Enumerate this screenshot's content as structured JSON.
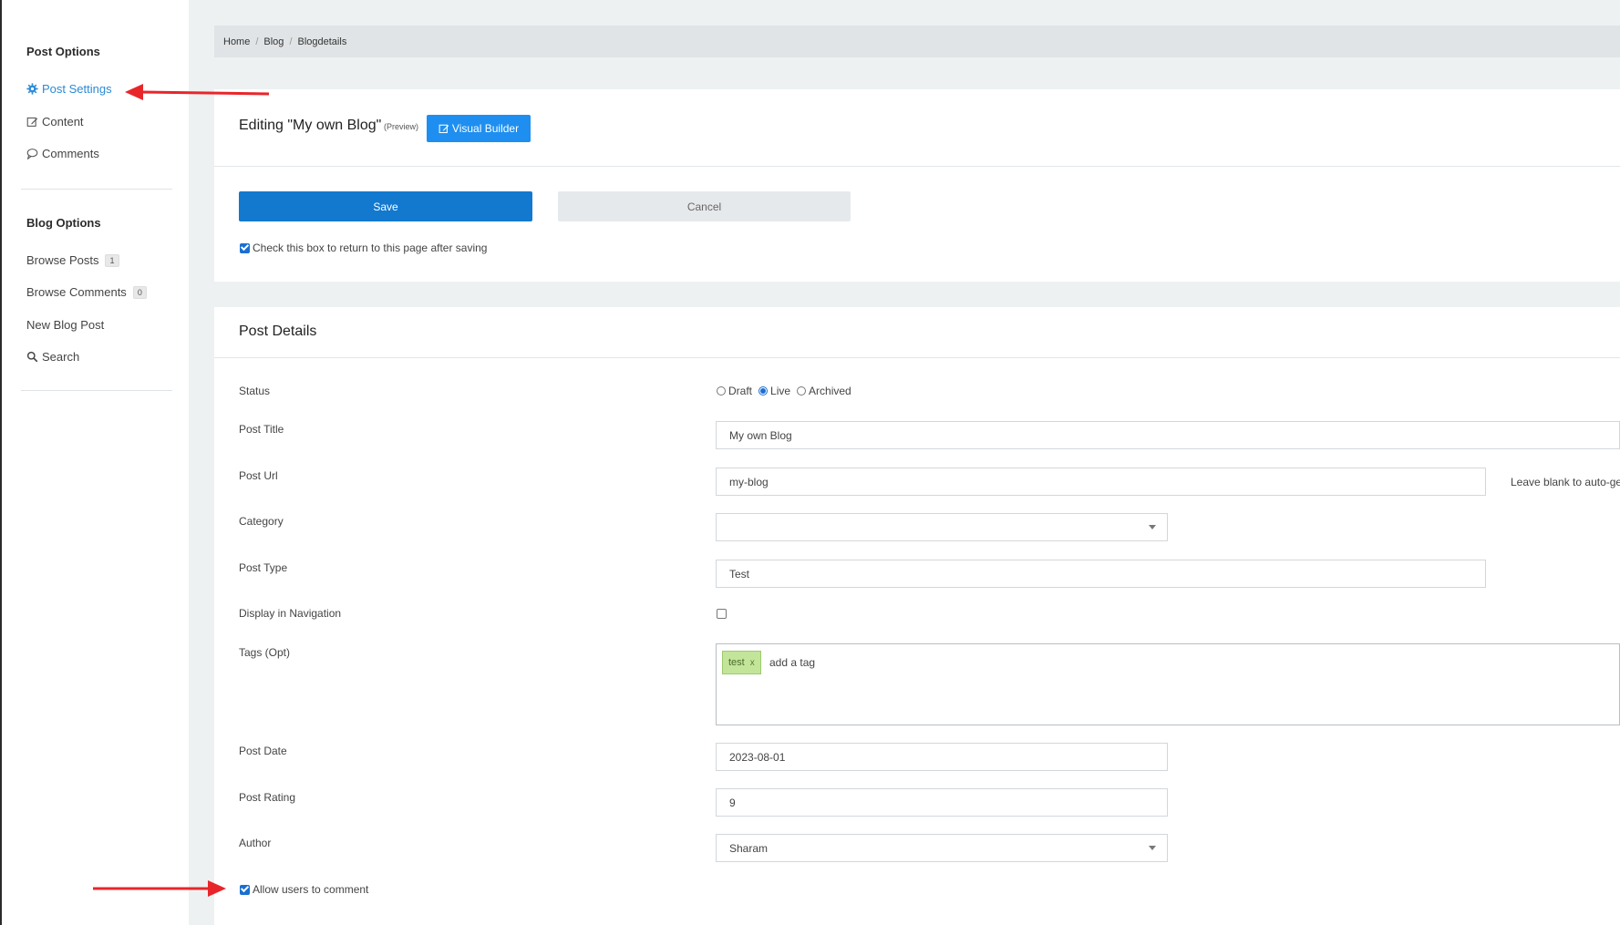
{
  "sidebar": {
    "post_options_title": "Post Options",
    "post_settings": "Post Settings",
    "content": "Content",
    "comments": "Comments",
    "blog_options_title": "Blog Options",
    "browse_posts": "Browse Posts",
    "browse_posts_count": "1",
    "browse_comments": "Browse Comments",
    "browse_comments_count": "0",
    "new_blog_post": "New Blog Post",
    "search": "Search"
  },
  "breadcrumb": {
    "home": "Home",
    "blog": "Blog",
    "current": "Blogdetails",
    "separator": "/"
  },
  "header": {
    "editing_title": "Editing \"My own Blog\"",
    "preview": "(Preview)",
    "visual_builder": "Visual Builder"
  },
  "actions": {
    "save": "Save",
    "cancel": "Cancel",
    "return_checkbox_label": "Check this box to return to this page after saving",
    "return_checked": true
  },
  "post_details": {
    "title": "Post Details",
    "status": {
      "label": "Status",
      "options": [
        "Draft",
        "Live",
        "Archived"
      ],
      "selected": "Live"
    },
    "post_title": {
      "label": "Post Title",
      "value": "My own Blog"
    },
    "post_url": {
      "label": "Post Url",
      "value": "my-blog",
      "hint": "Leave blank to auto-ge"
    },
    "category": {
      "label": "Category",
      "value": ""
    },
    "post_type": {
      "label": "Post Type",
      "value": "Test"
    },
    "display_in_navigation": {
      "label": "Display in Navigation",
      "checked": false
    },
    "tags": {
      "label": "Tags (Opt)",
      "items": [
        "test"
      ],
      "remove_glyph": "x",
      "placeholder": "add a tag"
    },
    "post_date": {
      "label": "Post Date",
      "value": "2023-08-01"
    },
    "post_rating": {
      "label": "Post Rating",
      "value": "9"
    },
    "author": {
      "label": "Author",
      "value": "Sharam"
    },
    "allow_comments": {
      "label": "Allow users to comment",
      "checked": true
    }
  },
  "colors": {
    "accent": "#2a8ad6",
    "save_button": "#1279cf",
    "visual_builder_button": "#1e8ff0",
    "annotation_arrow": "#e8262a",
    "tag_bg": "#c2e59a"
  }
}
